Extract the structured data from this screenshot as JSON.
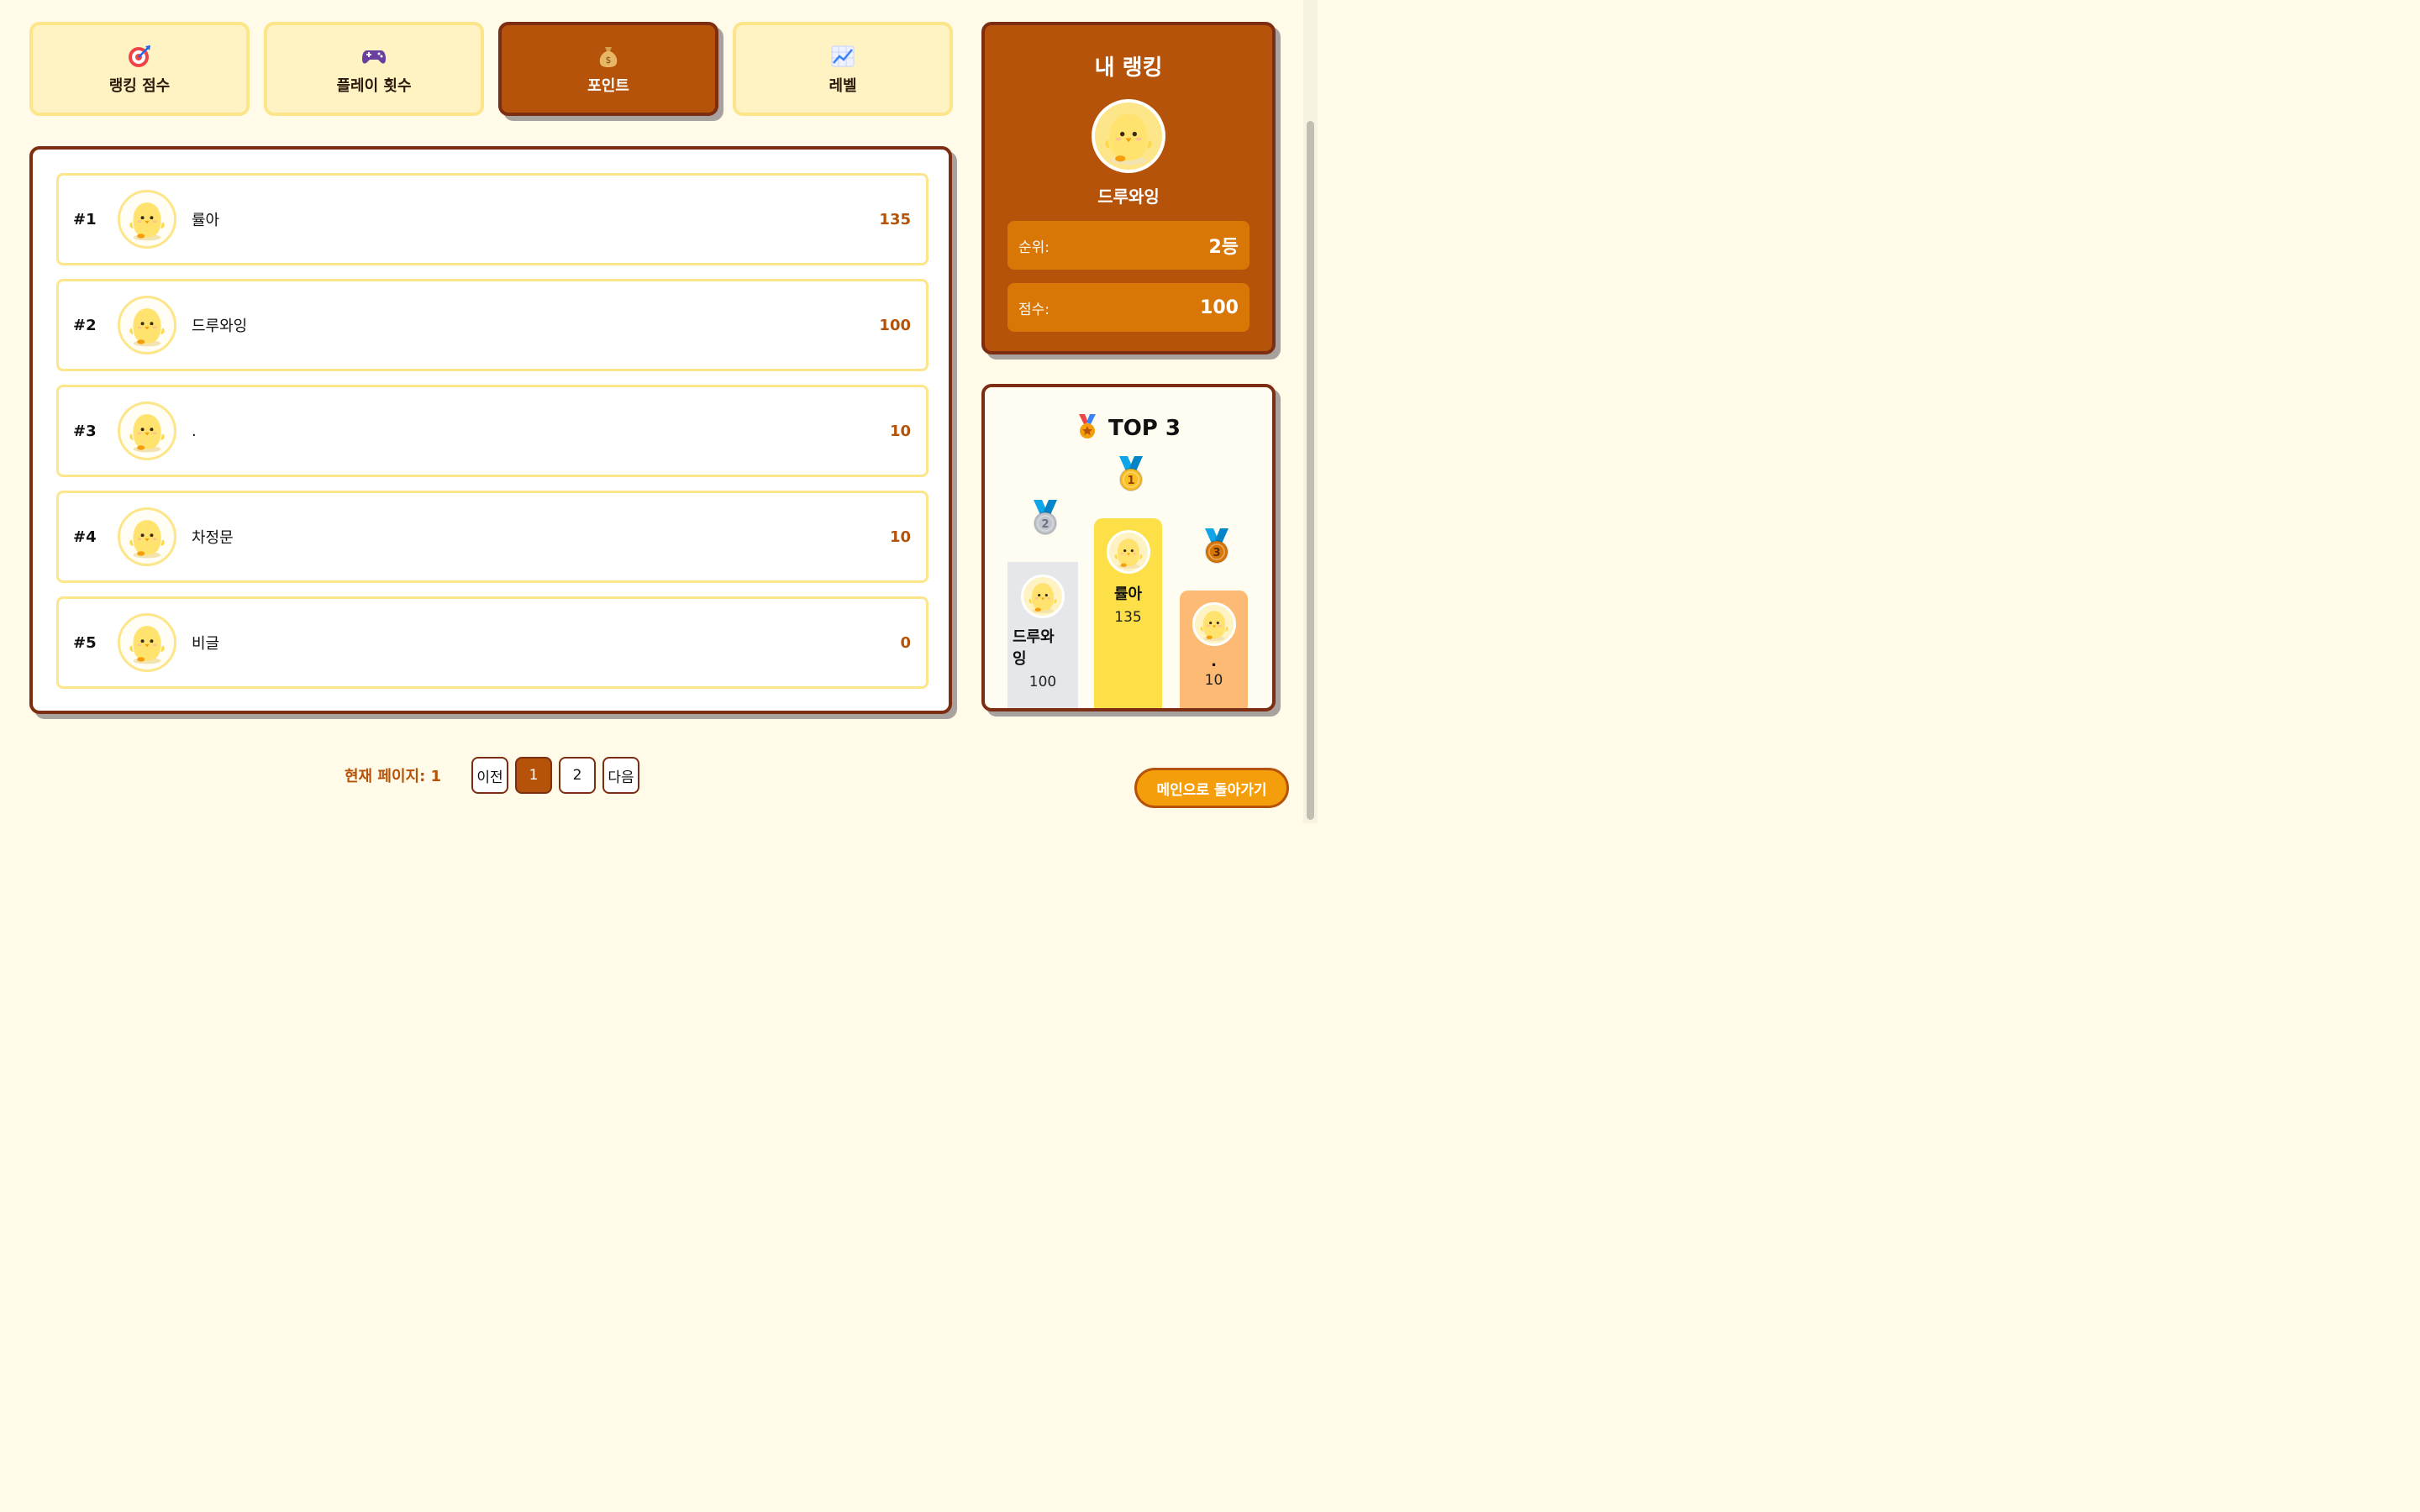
{
  "tabs": [
    {
      "label": "랭킹 점수",
      "icon": "target-icon",
      "active": false
    },
    {
      "label": "플레이 횟수",
      "icon": "gamepad-icon",
      "active": false
    },
    {
      "label": "포인트",
      "icon": "money-bag-icon",
      "active": true
    },
    {
      "label": "레벨",
      "icon": "chart-up-icon",
      "active": false
    }
  ],
  "ranking": [
    {
      "rank": "#1",
      "name": "률아",
      "score": "135"
    },
    {
      "rank": "#2",
      "name": "드루와잉",
      "score": "100"
    },
    {
      "rank": "#3",
      "name": ".",
      "score": "10"
    },
    {
      "rank": "#4",
      "name": "차정문",
      "score": "10"
    },
    {
      "rank": "#5",
      "name": "비글",
      "score": "0"
    }
  ],
  "pagination": {
    "info": "현재 페이지: 1",
    "prev": "이전",
    "pages": [
      "1",
      "2"
    ],
    "next": "다음",
    "current": "1"
  },
  "my_ranking": {
    "title": "내 랭킹",
    "name": "드루와잉",
    "rank_label": "순위:",
    "rank_value": "2등",
    "score_label": "점수:",
    "score_value": "100"
  },
  "top3": {
    "title": "TOP 3",
    "first": {
      "medal": "1",
      "name": "률아",
      "score": "135"
    },
    "second": {
      "medal": "2",
      "name": "드루와\n잉",
      "score": "100"
    },
    "third": {
      "medal": "3",
      "name": ".",
      "score": "10"
    }
  },
  "back_button": "메인으로 돌아가기",
  "colors": {
    "brand": "#b45309",
    "border": "#7c2d12",
    "tab_bg": "#fff3c4",
    "accent_orange": "#f59e0b",
    "gold": "#fde047",
    "silver": "#e5e7eb",
    "bronze": "#fdba74"
  }
}
